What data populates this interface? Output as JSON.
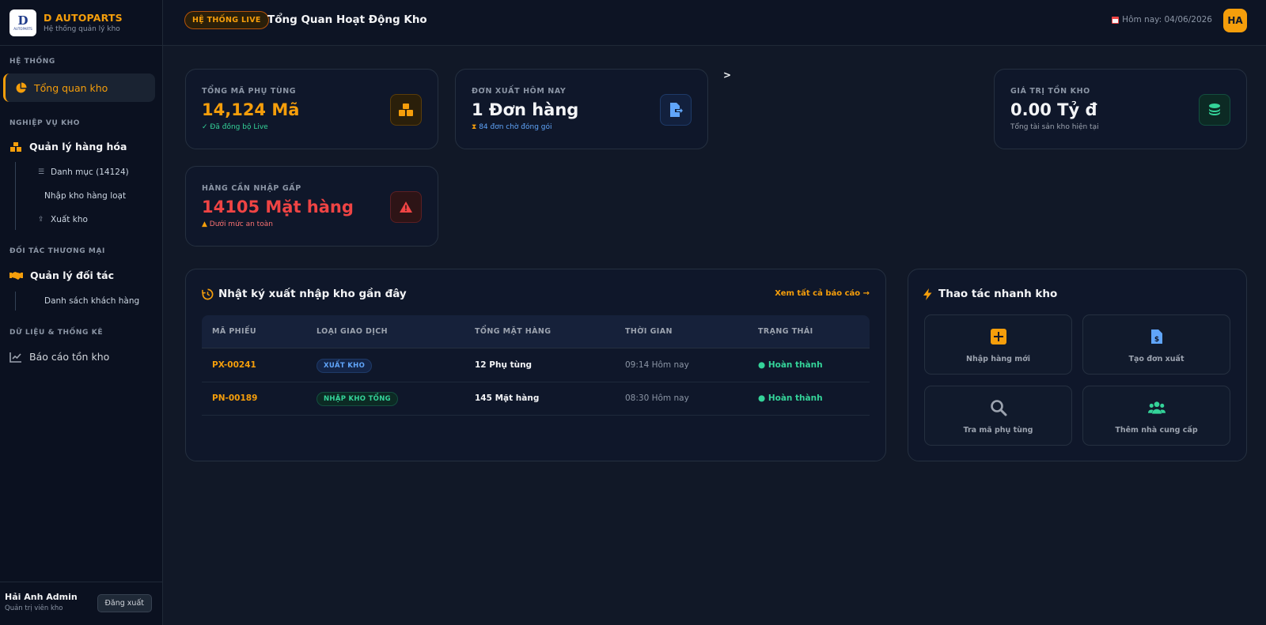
{
  "brand": {
    "name": "D AUTOPARTS",
    "subtitle": "Hệ thống quản lý kho",
    "logo_letter": "D",
    "logo_caption": "AUTOPARTS"
  },
  "sidebar": {
    "section_system": "HỆ THỐNG",
    "overview": "Tổng quan kho",
    "section_business": "NGHIỆP VỤ KHO",
    "goods": "Quản lý hàng hóa",
    "goods_items": [
      {
        "label": "Danh mục (14124)",
        "icon": "list-icon"
      },
      {
        "label": "Nhập kho hàng loạt",
        "icon": ""
      },
      {
        "label": "Xuất kho",
        "icon": "export-icon"
      }
    ],
    "section_partners": "ĐỐI TÁC THƯƠNG MẠI",
    "partners": "Quản lý đối tác",
    "partner_items": [
      {
        "label": "Danh sách khách hàng"
      }
    ],
    "section_reports": "DỮ LIỆU & THỐNG KÊ",
    "report": "Báo cáo tồn kho"
  },
  "user": {
    "name": "Hải Anh Admin",
    "role": "Quản trị viên kho",
    "logout": "Đăng xuất"
  },
  "header": {
    "badge": "HỆ THỐNG LIVE",
    "title": "Tổng Quan Hoạt Động Kho",
    "today": "Hôm nay: 04/06/2026",
    "avatar": "HA"
  },
  "stats": {
    "parts": {
      "label": "TỔNG MÃ PHỤ TÙNG",
      "value": "14,124 Mã",
      "sub": "✓ Đã đồng bộ Live",
      "icon": "boxes-icon"
    },
    "orders": {
      "label": "ĐƠN XUẤT HÔM NAY",
      "value": "1 Đơn hàng",
      "sub": "84 đơn chờ đóng gói",
      "icon": "file-export-icon"
    },
    "stray": ">",
    "value": {
      "label": "GIÁ TRỊ TỒN KHO",
      "value": "0.00 Tỷ đ",
      "sub": "Tổng tài sản kho hiện tại",
      "icon": "coins-icon"
    },
    "urgent": {
      "label": "HÀNG CẦN NHẬP GẤP",
      "value": "14105 Mặt hàng",
      "sub": "Dưới mức an toàn",
      "icon": "warning-icon"
    }
  },
  "log": {
    "title": "Nhật ký xuất nhập kho gần đây",
    "see_all": "Xem tất cả báo cáo →",
    "columns": [
      "MÃ PHIẾU",
      "LOẠI GIAO DỊCH",
      "TỔNG MẶT HÀNG",
      "THỜI GIAN",
      "TRẠNG THÁI"
    ],
    "rows": [
      {
        "code": "PX-00241",
        "type": "XUẤT KHO",
        "items": "12 Phụ tùng",
        "time": "09:14 Hôm nay",
        "status": "● Hoàn thành"
      },
      {
        "code": "PN-00189",
        "type": "NHẬP KHO TỔNG",
        "items": "145 Mặt hàng",
        "time": "08:30 Hôm nay",
        "status": "● Hoàn thành"
      }
    ]
  },
  "quick": {
    "title": "Thao tác nhanh kho",
    "actions": [
      {
        "label": "Nhập hàng mới",
        "icon": "plus-box-icon"
      },
      {
        "label": "Tạo đơn xuất",
        "icon": "invoice-icon"
      },
      {
        "label": "Tra mã phụ tùng",
        "icon": "search-icon"
      },
      {
        "label": "Thêm nhà cung cấp",
        "icon": "users-add-icon"
      }
    ]
  },
  "colors": {
    "accent": "#f59e0b",
    "danger": "#ef4444",
    "info": "#60a5fa",
    "success": "#34d399",
    "background": "#111827",
    "sidebar": "#0b1120",
    "card": "#0f172a"
  }
}
